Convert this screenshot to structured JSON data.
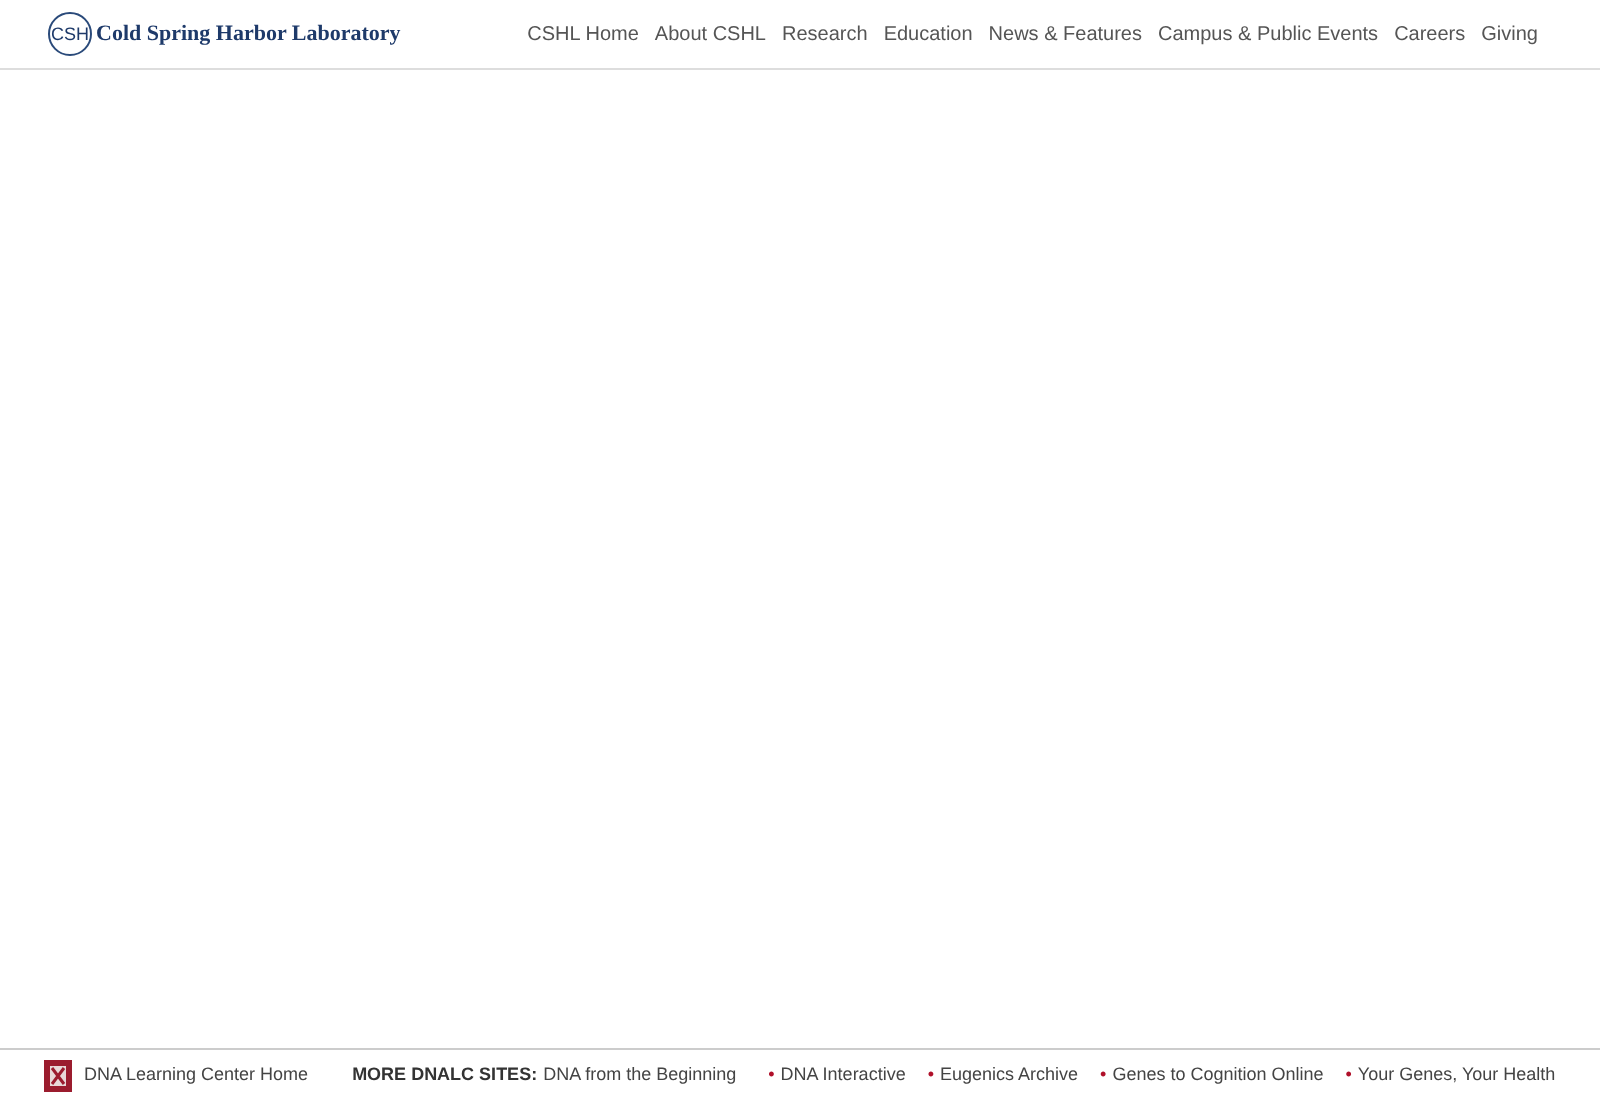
{
  "header": {
    "logo_mark": "CSH",
    "logo_text": "Cold Spring Harbor Laboratory",
    "nav": [
      "CSHL Home",
      "About CSHL",
      "Research",
      "Education",
      "News & Features",
      "Campus & Public Events",
      "Careers",
      "Giving"
    ]
  },
  "footer": {
    "home_link": "DNA Learning Center Home",
    "sites_label": "MORE DNALC SITES:",
    "first_site": "DNA from the Beginning",
    "sites": [
      {
        "bullet": "•",
        "label": "DNA Interactive"
      },
      {
        "bullet": "•",
        "label": "Eugenics Archive"
      },
      {
        "bullet": "•",
        "label": "Genes to Cognition Online"
      },
      {
        "bullet": "•",
        "label": "Your Genes, Your Health"
      }
    ]
  }
}
